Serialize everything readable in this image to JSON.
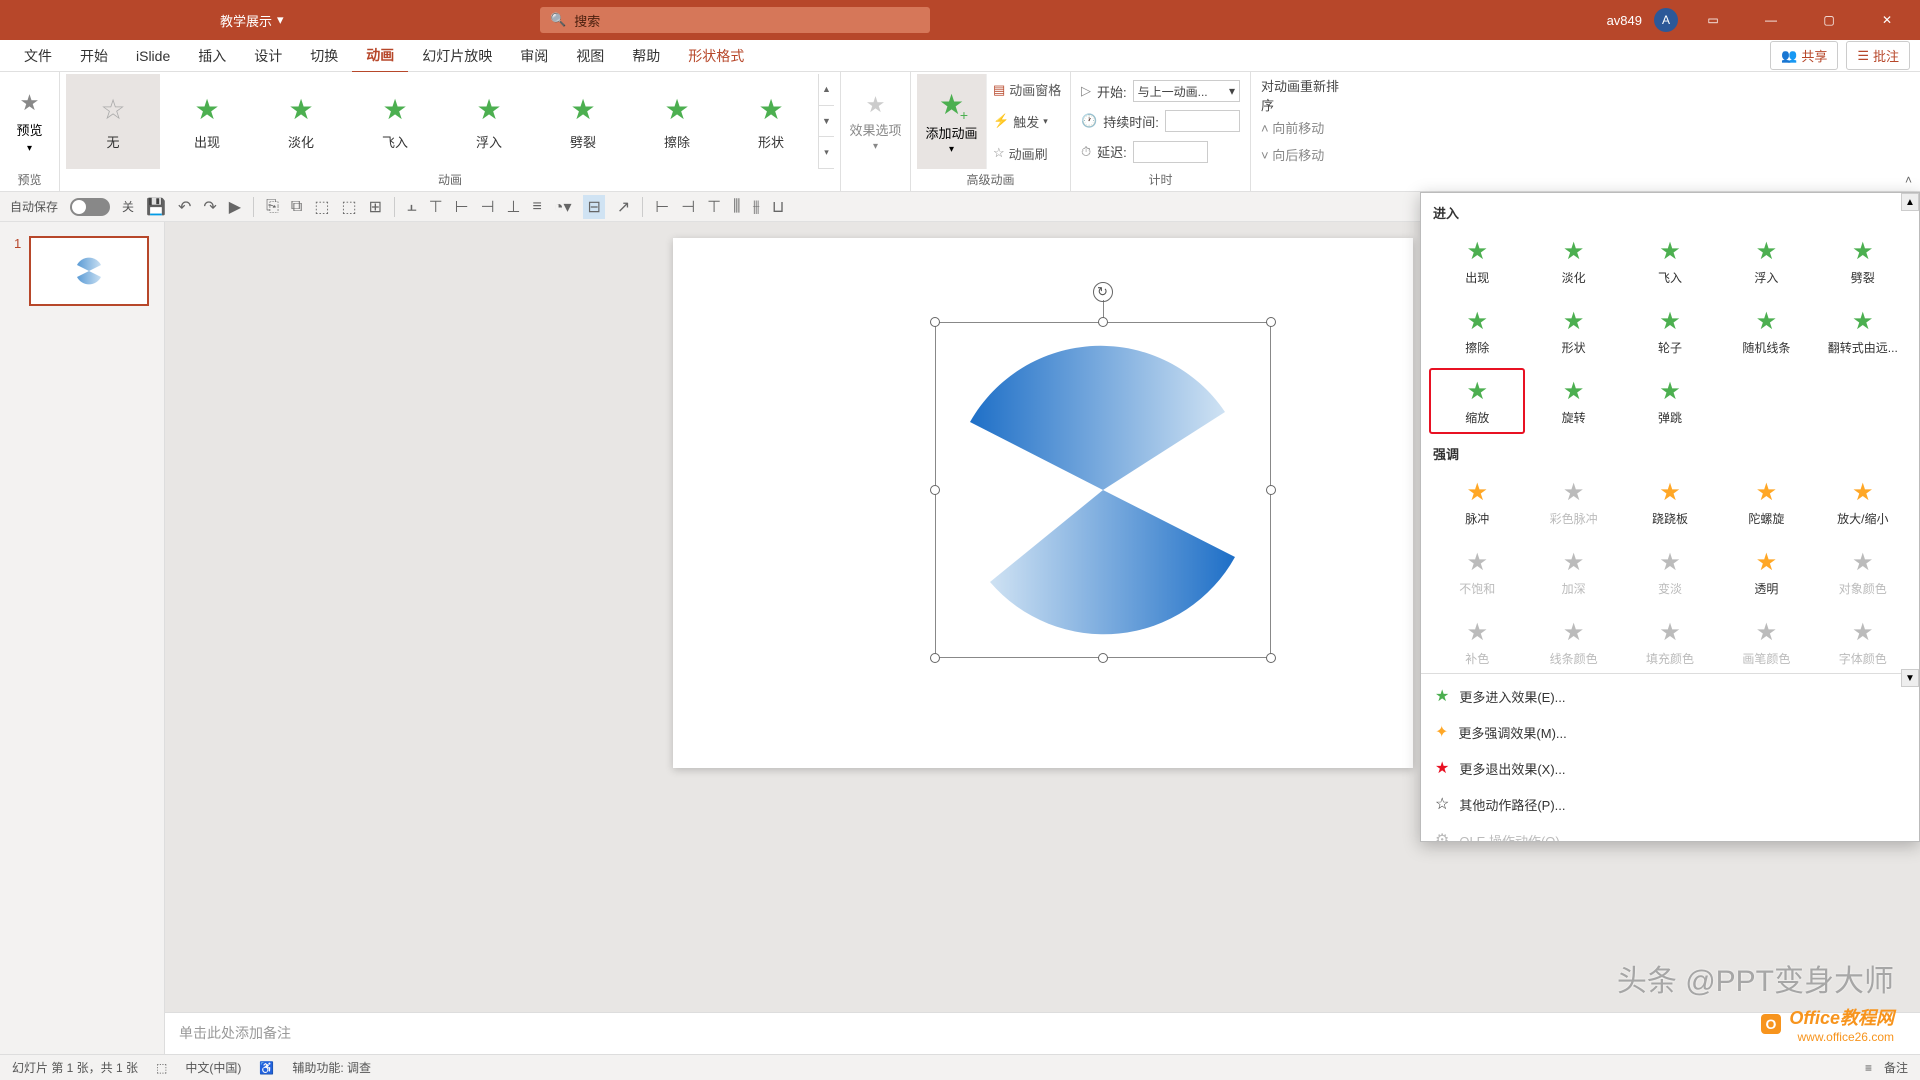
{
  "title_bar": {
    "doc_title": "教学展示",
    "search_placeholder": "搜索",
    "user_name": "av849",
    "user_initial": "A"
  },
  "menu": {
    "items": [
      "文件",
      "开始",
      "iSlide",
      "插入",
      "设计",
      "切换",
      "动画",
      "幻灯片放映",
      "审阅",
      "视图",
      "帮助",
      "形状格式"
    ],
    "active": "动画",
    "share": "共享",
    "comments": "批注"
  },
  "ribbon": {
    "preview_group": "预览",
    "preview_btn": "预览",
    "anim_group": "动画",
    "none": "无",
    "gallery": [
      "出现",
      "淡化",
      "飞入",
      "浮入",
      "劈裂",
      "擦除",
      "形状"
    ],
    "effect_options": "效果选项",
    "add_anim": "添加动画",
    "anim_pane": "动画窗格",
    "trigger": "触发",
    "anim_painter": "动画刷",
    "start_label": "开始:",
    "start_value": "与上一动画...",
    "duration_label": "持续时间:",
    "delay_label": "延迟:",
    "reorder_title": "对动画重新排序",
    "move_earlier": "向前移动",
    "move_later": "向后移动",
    "advanced_group": "高级动画",
    "timing_group": "计时"
  },
  "qat": {
    "autosave": "自动保存",
    "off": "关"
  },
  "anim_panel": {
    "entrance_title": "进入",
    "entrance": [
      "出现",
      "淡化",
      "飞入",
      "浮入",
      "劈裂",
      "擦除",
      "形状",
      "轮子",
      "随机线条",
      "翻转式由远...",
      "缩放",
      "旋转",
      "弹跳"
    ],
    "emphasis_title": "强调",
    "emphasis_orange": [
      "脉冲",
      "彩色脉冲",
      "跷跷板",
      "陀螺旋",
      "放大/缩小"
    ],
    "emphasis_gray1": [
      "不饱和",
      "加深",
      "变淡",
      "透明",
      "对象颜色"
    ],
    "emphasis_gray2": [
      "补色",
      "线条颜色",
      "填充颜色",
      "画笔颜色",
      "字体颜色"
    ],
    "more_entrance": "更多进入效果(E)...",
    "more_emphasis": "更多强调效果(M)...",
    "more_exit": "更多退出效果(X)...",
    "more_motion": "其他动作路径(P)...",
    "ole_action": "OLE 操作动作(O)..."
  },
  "slide": {
    "notes_placeholder": "单击此处添加备注"
  },
  "status": {
    "slide_info": "幻灯片 第 1 张，共 1 张",
    "language": "中文(中国)",
    "accessibility": "辅助功能: 调查",
    "notes_btn": "备注"
  },
  "thumbnails": {
    "slide1_num": "1"
  },
  "watermark": {
    "main": "头条 @PPT变身大师",
    "brand": "Office教程网",
    "url": "www.office26.com"
  }
}
